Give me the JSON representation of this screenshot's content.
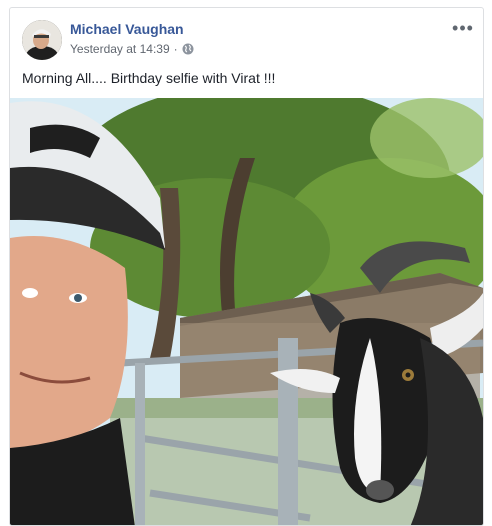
{
  "post": {
    "author": "Michael Vaughan",
    "timestamp": "Yesterday at 14:39",
    "separator": "·",
    "privacy_icon": "globe-icon",
    "more_icon": "more-options-icon",
    "more_label": "•••",
    "text": "Morning All.... Birthday selfie with Virat !!!"
  },
  "colors": {
    "author_link": "#385898",
    "meta_text": "#616770",
    "border": "#dddfe2"
  }
}
